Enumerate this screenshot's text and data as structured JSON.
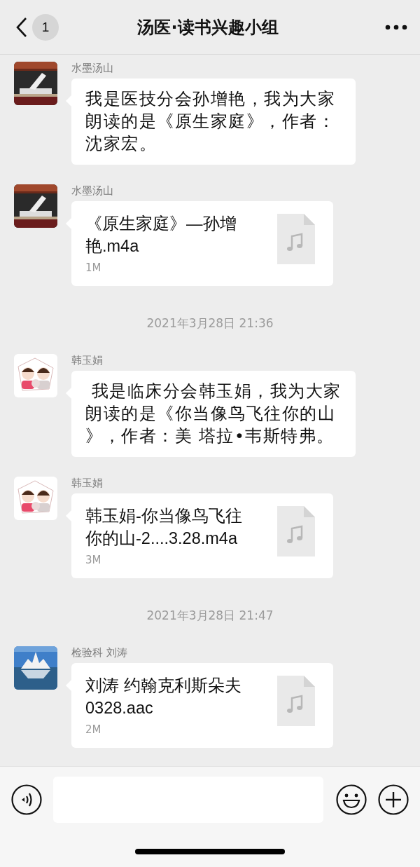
{
  "header": {
    "back_count": "1",
    "title": "汤医·读书兴趣小组"
  },
  "feed": [
    {
      "kind": "text_message",
      "sender": "水墨汤山",
      "text": "我是医技分会孙增艳，我为大家朗读的是《原生家庭》，作者：沈家宏。"
    },
    {
      "kind": "file_message",
      "sender": "水墨汤山",
      "file_name": "《原生家庭》—孙增艳.m4a",
      "size": "1M"
    },
    {
      "kind": "timestamp",
      "text": "2021年3月28日 21:36"
    },
    {
      "kind": "text_message",
      "sender": "韩玉娟",
      "text": " 我是临床分会韩玉娟，我为大家朗读的是《你当像鸟飞往你的山》，作者：美 塔拉•韦斯特弗。"
    },
    {
      "kind": "file_message",
      "sender": "韩玉娟",
      "file_name": "韩玉娟-你当像鸟飞往你的山-2....3.28.m4a",
      "size": "3M"
    },
    {
      "kind": "timestamp",
      "text": "2021年3月28日 21:47"
    },
    {
      "kind": "file_message",
      "sender": "检验科 刘涛",
      "file_name": "刘涛 约翰克利斯朵夫0328.aac",
      "size": "2M"
    }
  ]
}
